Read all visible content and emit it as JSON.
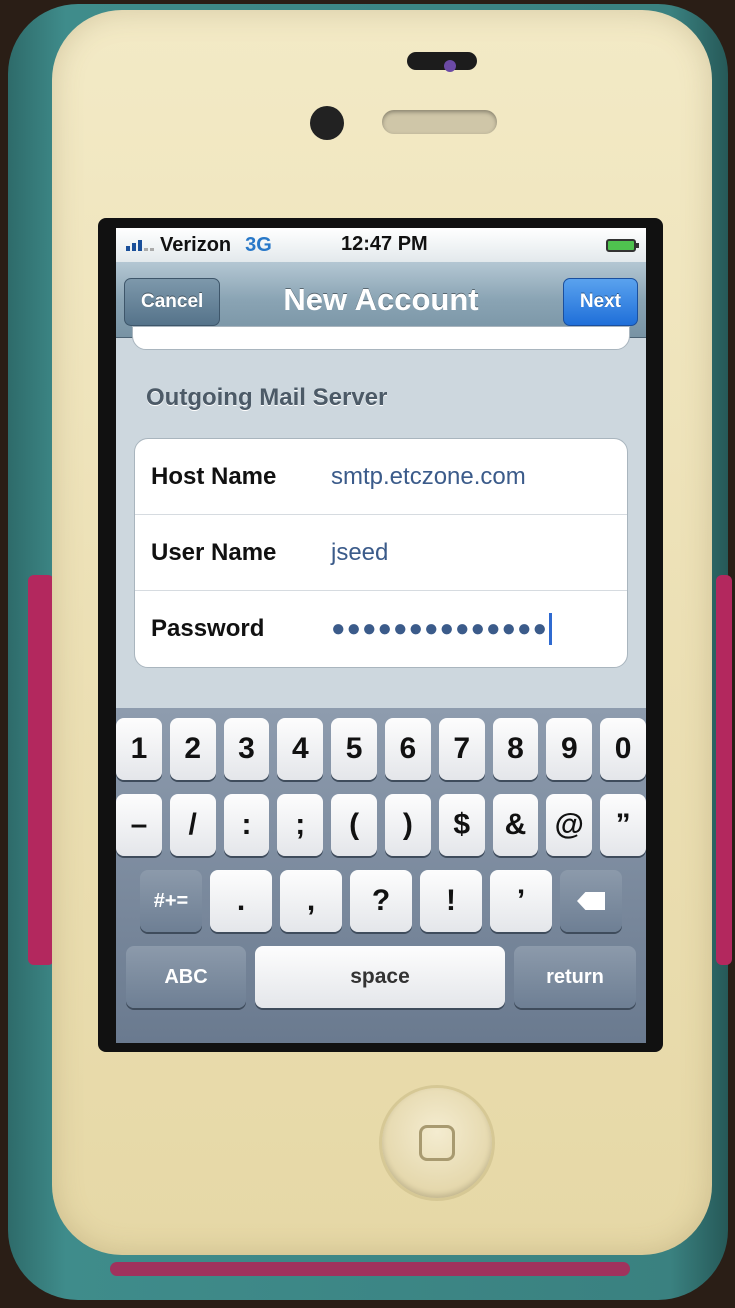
{
  "status": {
    "carrier": "Verizon",
    "network": "3G",
    "time": "12:47 PM"
  },
  "nav": {
    "cancel_label": "Cancel",
    "title": "New Account",
    "next_label": "Next"
  },
  "section": {
    "title": "Outgoing Mail Server"
  },
  "fields": [
    {
      "label": "Host Name",
      "value": "smtp.etczone.com"
    },
    {
      "label": "User Name",
      "value": "jseed"
    },
    {
      "label": "Password",
      "value": "●●●●●●●●●●●●●●"
    }
  ],
  "keyboard": {
    "row1": [
      "1",
      "2",
      "3",
      "4",
      "5",
      "6",
      "7",
      "8",
      "9",
      "0"
    ],
    "row2": [
      "–",
      "/",
      ":",
      ";",
      "(",
      ")",
      "$",
      "&",
      "@",
      "”"
    ],
    "row3": [
      ".",
      ",",
      "?",
      "!",
      "’"
    ],
    "symbols_label": "#+=",
    "abc_label": "ABC",
    "space_label": "space",
    "return_label": "return"
  },
  "icons": {
    "backspace": "backspace-icon",
    "battery": "battery-icon",
    "signal": "signal-icon"
  }
}
